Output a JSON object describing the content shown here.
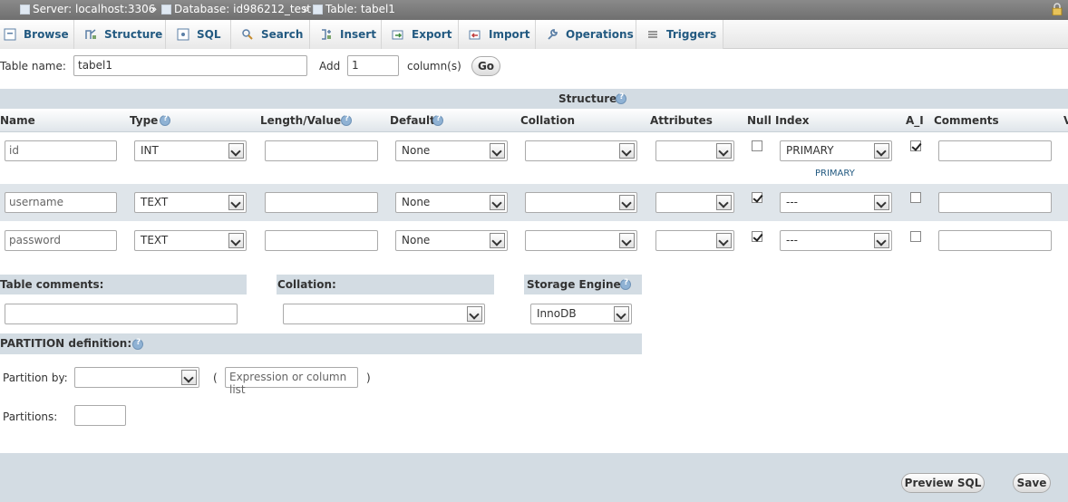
{
  "breadcrumb": {
    "server": "Server: localhost:3306",
    "sep1": "»",
    "database": "Database: id986212_test",
    "sep2": "»",
    "table": "Table: tabel1"
  },
  "tabs": [
    {
      "label": "Browse",
      "icon": "browse-icon"
    },
    {
      "label": "Structure",
      "icon": "structure-icon"
    },
    {
      "label": "SQL",
      "icon": "sql-icon"
    },
    {
      "label": "Search",
      "icon": "search-icon"
    },
    {
      "label": "Insert",
      "icon": "insert-icon"
    },
    {
      "label": "Export",
      "icon": "export-icon"
    },
    {
      "label": "Import",
      "icon": "import-icon"
    },
    {
      "label": "Operations",
      "icon": "wrench-icon"
    },
    {
      "label": "Triggers",
      "icon": "triggers-icon"
    }
  ],
  "table_name": {
    "label": "Table name:",
    "value": "tabel1",
    "add_label": "Add",
    "add_value": "1",
    "columns_label": "column(s)",
    "go_label": "Go"
  },
  "structure": {
    "title": "Structure",
    "headers": {
      "name": "Name",
      "type": "Type",
      "length": "Length/Values",
      "default": "Default",
      "collation": "Collation",
      "attributes": "Attributes",
      "null": "Null",
      "index": "Index",
      "ai": "A_I",
      "comments": "Comments",
      "v": "V"
    },
    "rows": [
      {
        "name": "id",
        "type": "INT",
        "length": "",
        "default": "None",
        "collation": "",
        "attributes": "",
        "null": false,
        "index": "PRIMARY",
        "index_note": "PRIMARY",
        "ai": true,
        "comments": ""
      },
      {
        "name": "username",
        "type": "TEXT",
        "length": "",
        "default": "None",
        "collation": "",
        "attributes": "",
        "null": true,
        "index": "---",
        "index_note": "",
        "ai": false,
        "comments": ""
      },
      {
        "name": "password",
        "type": "TEXT",
        "length": "",
        "default": "None",
        "collation": "",
        "attributes": "",
        "null": true,
        "index": "---",
        "index_note": "",
        "ai": false,
        "comments": ""
      }
    ]
  },
  "table_options": {
    "comments_label": "Table comments:",
    "comments_value": "",
    "collation_label": "Collation:",
    "collation_value": "",
    "engine_label": "Storage Engine:",
    "engine_value": "InnoDB"
  },
  "partition": {
    "title": "PARTITION definition:",
    "by_label": "Partition by:",
    "by_value": "",
    "open_paren": "(",
    "expression_placeholder": "Expression or column list",
    "close_paren": ")",
    "partitions_label": "Partitions:",
    "partitions_value": ""
  },
  "footer": {
    "preview_label": "Preview SQL",
    "save_label": "Save"
  },
  "colors": {
    "tab_text": "#235a81",
    "section_bg": "#d3dce3",
    "topbar_bg": "#7a7a7a"
  }
}
